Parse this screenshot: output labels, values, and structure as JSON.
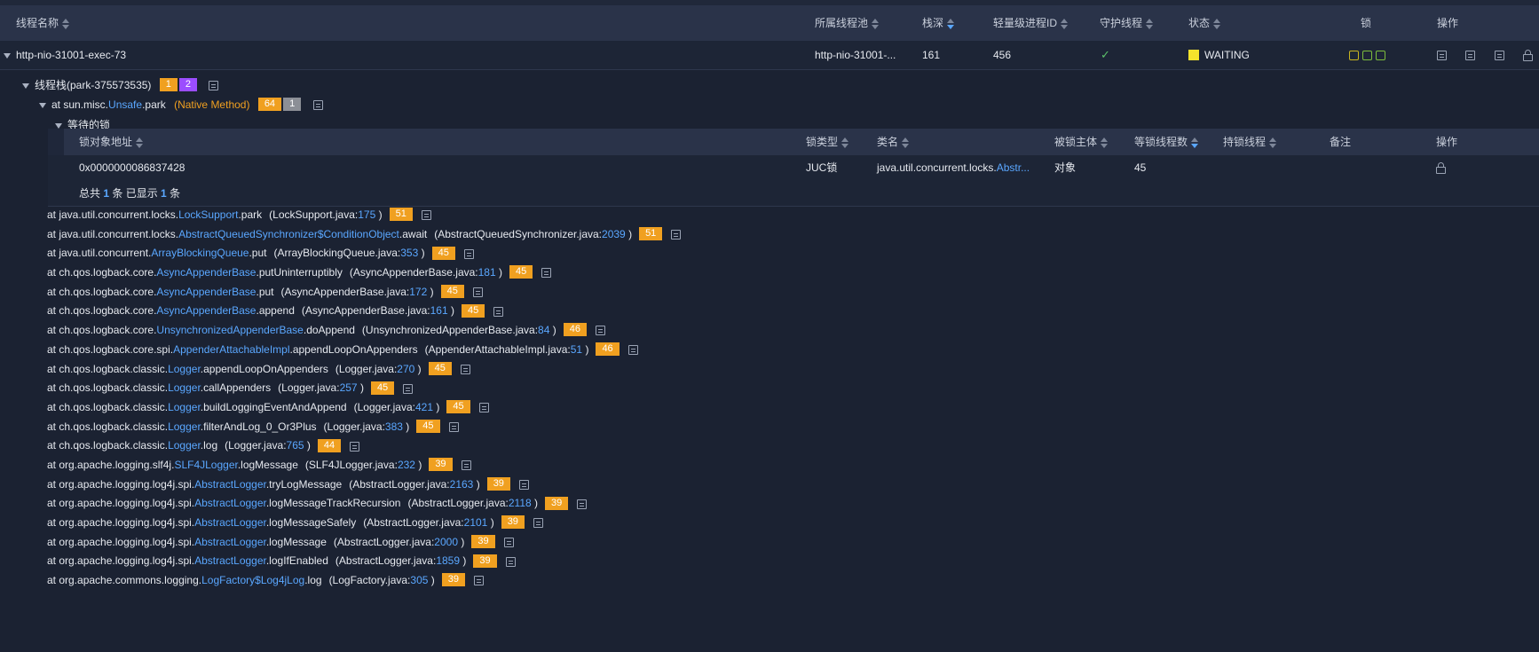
{
  "thread_table": {
    "columns": [
      {
        "label": "线程名称",
        "sort": "none"
      },
      {
        "label": "所属线程池",
        "sort": "none"
      },
      {
        "label": "栈深",
        "sort": "desc"
      },
      {
        "label": "轻量级进程ID",
        "sort": "none"
      },
      {
        "label": "守护线程",
        "sort": "none"
      },
      {
        "label": "状态",
        "sort": "none"
      },
      {
        "label": "锁",
        "sort": null
      },
      {
        "label": "操作",
        "sort": null
      }
    ],
    "row": {
      "name": "http-nio-31001-exec-73",
      "pool": "http-nio-31001-...",
      "depth": "161",
      "lwp": "456",
      "daemon": "✓",
      "state": "WAITING",
      "state_color": "#f5e32c"
    }
  },
  "stack": {
    "label": "线程栈",
    "park_id": "(park-375573535)",
    "badges": [
      "1",
      "2"
    ],
    "top_frame": {
      "prefix": "at sun.misc.",
      "cls": "Unsafe",
      "method": ".park",
      "native": "(Native Method)",
      "badges": [
        "64",
        "1"
      ]
    },
    "waiting_locks_label": "等待的锁"
  },
  "lock_table": {
    "columns": [
      {
        "label": "锁对象地址",
        "sort": "none"
      },
      {
        "label": "锁类型",
        "sort": "none"
      },
      {
        "label": "类名",
        "sort": "none"
      },
      {
        "label": "被锁主体",
        "sort": "none"
      },
      {
        "label": "等锁线程数",
        "sort": "desc"
      },
      {
        "label": "持锁线程",
        "sort": "none"
      },
      {
        "label": "备注",
        "sort": null
      },
      {
        "label": "操作",
        "sort": null
      }
    ],
    "row": {
      "address": "0x0000000086837428",
      "type": "JUC锁",
      "class_prefix": "java.util.concurrent.locks.",
      "class_hl": "Abstr...",
      "subject": "对象",
      "waiters": "45"
    },
    "footer": {
      "p1": "总共 ",
      "total": "1",
      "p2": " 条 已显示 ",
      "shown": "1",
      "p3": " 条"
    }
  },
  "frames": [
    {
      "pkg": "at java.util.concurrent.locks.",
      "cls": "LockSupport",
      "method": ".park",
      "file": "(LockSupport.java:",
      "line": "175",
      "close": ")",
      "badge": "51"
    },
    {
      "pkg": "at java.util.concurrent.locks.",
      "cls": "AbstractQueuedSynchronizer$ConditionObject",
      "method": ".await",
      "file": "(AbstractQueuedSynchronizer.java:",
      "line": "2039",
      "close": ")",
      "badge": "51"
    },
    {
      "pkg": "at java.util.concurrent.",
      "cls": "ArrayBlockingQueue",
      "method": ".put",
      "file": "(ArrayBlockingQueue.java:",
      "line": "353",
      "close": ")",
      "badge": "45"
    },
    {
      "pkg": "at ch.qos.logback.core.",
      "cls": "AsyncAppenderBase",
      "method": ".putUninterruptibly",
      "file": "(AsyncAppenderBase.java:",
      "line": "181",
      "close": ")",
      "badge": "45"
    },
    {
      "pkg": "at ch.qos.logback.core.",
      "cls": "AsyncAppenderBase",
      "method": ".put",
      "file": "(AsyncAppenderBase.java:",
      "line": "172",
      "close": ")",
      "badge": "45"
    },
    {
      "pkg": "at ch.qos.logback.core.",
      "cls": "AsyncAppenderBase",
      "method": ".append",
      "file": "(AsyncAppenderBase.java:",
      "line": "161",
      "close": ")",
      "badge": "45"
    },
    {
      "pkg": "at ch.qos.logback.core.",
      "cls": "UnsynchronizedAppenderBase",
      "method": ".doAppend",
      "file": "(UnsynchronizedAppenderBase.java:",
      "line": "84",
      "close": ")",
      "badge": "46"
    },
    {
      "pkg": "at ch.qos.logback.core.spi.",
      "cls": "AppenderAttachableImpl",
      "method": ".appendLoopOnAppenders",
      "file": "(AppenderAttachableImpl.java:",
      "line": "51",
      "close": ")",
      "badge": "46"
    },
    {
      "pkg": "at ch.qos.logback.classic.",
      "cls": "Logger",
      "method": ".appendLoopOnAppenders",
      "file": "(Logger.java:",
      "line": "270",
      "close": ")",
      "badge": "45"
    },
    {
      "pkg": "at ch.qos.logback.classic.",
      "cls": "Logger",
      "method": ".callAppenders",
      "file": "(Logger.java:",
      "line": "257",
      "close": ")",
      "badge": "45"
    },
    {
      "pkg": "at ch.qos.logback.classic.",
      "cls": "Logger",
      "method": ".buildLoggingEventAndAppend",
      "file": "(Logger.java:",
      "line": "421",
      "close": ")",
      "badge": "45"
    },
    {
      "pkg": "at ch.qos.logback.classic.",
      "cls": "Logger",
      "method": ".filterAndLog_0_Or3Plus",
      "file": "(Logger.java:",
      "line": "383",
      "close": ")",
      "badge": "45"
    },
    {
      "pkg": "at ch.qos.logback.classic.",
      "cls": "Logger",
      "method": ".log",
      "file": "(Logger.java:",
      "line": "765",
      "close": ")",
      "badge": "44"
    },
    {
      "pkg": "at org.apache.logging.slf4j.",
      "cls": "SLF4JLogger",
      "method": ".logMessage",
      "file": "(SLF4JLogger.java:",
      "line": "232",
      "close": ")",
      "badge": "39"
    },
    {
      "pkg": "at org.apache.logging.log4j.spi.",
      "cls": "AbstractLogger",
      "method": ".tryLogMessage",
      "file": "(AbstractLogger.java:",
      "line": "2163",
      "close": ")",
      "badge": "39"
    },
    {
      "pkg": "at org.apache.logging.log4j.spi.",
      "cls": "AbstractLogger",
      "method": ".logMessageTrackRecursion",
      "file": "(AbstractLogger.java:",
      "line": "2118",
      "close": ")",
      "badge": "39"
    },
    {
      "pkg": "at org.apache.logging.log4j.spi.",
      "cls": "AbstractLogger",
      "method": ".logMessageSafely",
      "file": "(AbstractLogger.java:",
      "line": "2101",
      "close": ")",
      "badge": "39"
    },
    {
      "pkg": "at org.apache.logging.log4j.spi.",
      "cls": "AbstractLogger",
      "method": ".logMessage",
      "file": "(AbstractLogger.java:",
      "line": "2000",
      "close": ")",
      "badge": "39"
    },
    {
      "pkg": "at org.apache.logging.log4j.spi.",
      "cls": "AbstractLogger",
      "method": ".logIfEnabled",
      "file": "(AbstractLogger.java:",
      "line": "1859",
      "close": ")",
      "badge": "39"
    },
    {
      "pkg": "at org.apache.commons.logging.",
      "cls": "LogFactory$Log4jLog",
      "method": ".log",
      "file": "(LogFactory.java:",
      "line": "305",
      "close": ")",
      "badge": "39"
    }
  ]
}
